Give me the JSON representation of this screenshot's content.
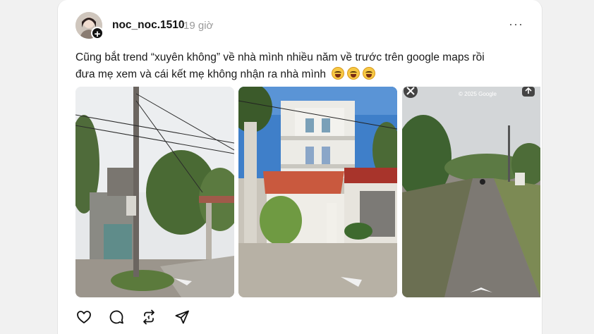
{
  "post": {
    "username": "noc_noc.1510",
    "time": "19 giờ",
    "more_label": "···",
    "text_line1": "Cũng bắt trend “xuyên không” về nhà mình nhiều năm về trước trên google maps rồi",
    "text_line2": "đưa mẹ xem và cái kết mẹ không nhận ra nhà mình",
    "emoji": "grinning-sweat-emoji"
  },
  "photos": [
    {
      "alt": "street-view-house-with-utility-pole"
    },
    {
      "alt": "street-view-three-storey-house"
    },
    {
      "alt": "street-view-village-road",
      "watermark": "© 2025 Google"
    }
  ],
  "actions": [
    "like-icon",
    "comment-icon",
    "repost-icon",
    "share-icon"
  ],
  "colors": {
    "background": "#f1f1f1",
    "card": "#ffffff",
    "muted": "#9a9a9a"
  }
}
